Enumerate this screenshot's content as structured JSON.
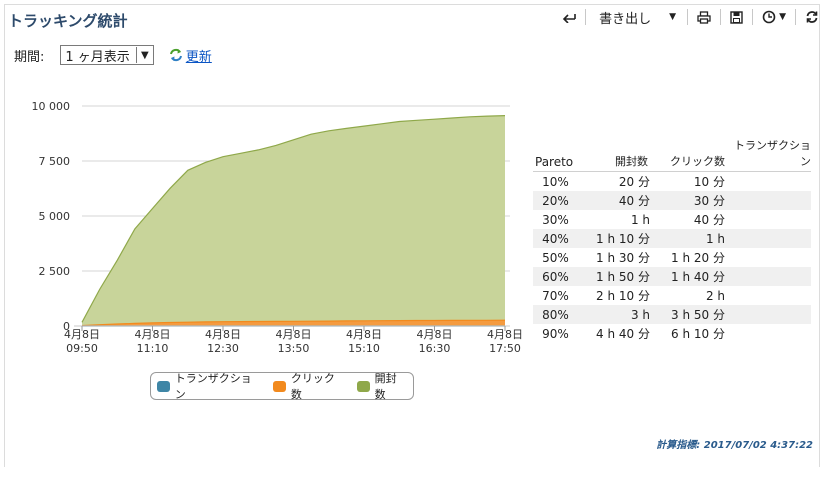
{
  "title": "トラッキング統計",
  "toolbar": {
    "export_label": "書き出し"
  },
  "period": {
    "label": "期間:",
    "selected": "1 ヶ月表示",
    "refresh_label": "更新"
  },
  "chart_data": {
    "type": "area",
    "stacked": true,
    "x": [
      "09:50",
      "10:10",
      "10:30",
      "10:50",
      "11:10",
      "11:30",
      "11:50",
      "12:10",
      "12:30",
      "12:50",
      "13:10",
      "13:30",
      "13:50",
      "14:10",
      "14:30",
      "14:50",
      "15:10",
      "15:30",
      "15:50",
      "16:10",
      "16:30",
      "16:50",
      "17:10",
      "17:30",
      "17:50"
    ],
    "x_ticks": [
      {
        "date": "4月8日",
        "time": "09:50",
        "index": 0
      },
      {
        "date": "4月8日",
        "time": "11:10",
        "index": 4
      },
      {
        "date": "4月8日",
        "time": "12:30",
        "index": 8
      },
      {
        "date": "4月8日",
        "time": "13:50",
        "index": 12
      },
      {
        "date": "4月8日",
        "time": "15:10",
        "index": 16
      },
      {
        "date": "4月8日",
        "time": "16:30",
        "index": 20
      },
      {
        "date": "4月8日",
        "time": "17:50",
        "index": 24
      }
    ],
    "y_ticks": [
      {
        "value": 0,
        "label": "0"
      },
      {
        "value": 2500,
        "label": "2 500"
      },
      {
        "value": 5000,
        "label": "5 000"
      },
      {
        "value": 7500,
        "label": "7 500"
      },
      {
        "value": 10000,
        "label": "10 000"
      }
    ],
    "ylim": [
      0,
      10000
    ],
    "series": [
      {
        "name": "トランザクション",
        "color": "#3f86a6",
        "values": [
          0,
          0,
          0,
          0,
          0,
          0,
          0,
          0,
          0,
          0,
          0,
          0,
          0,
          0,
          0,
          0,
          0,
          0,
          0,
          0,
          0,
          0,
          0,
          0,
          0
        ]
      },
      {
        "name": "クリック数",
        "color": "#f28a1e",
        "values": [
          20,
          60,
          90,
          120,
          140,
          160,
          175,
          185,
          195,
          200,
          205,
          210,
          215,
          220,
          225,
          230,
          235,
          240,
          245,
          250,
          252,
          255,
          258,
          260,
          262
        ]
      },
      {
        "name": "開封数",
        "color": "#8fa84a",
        "fill": "#c8d49a",
        "values": [
          150,
          1600,
          2900,
          4300,
          5200,
          6100,
          6900,
          7250,
          7500,
          7650,
          7800,
          8000,
          8250,
          8500,
          8650,
          8750,
          8850,
          8950,
          9050,
          9100,
          9150,
          9200,
          9250,
          9280,
          9300
        ]
      }
    ],
    "grid": true,
    "legend_position": "bottom"
  },
  "legend": {
    "transaction": "トランザクション",
    "clicks": "クリック数",
    "opens": "開封数"
  },
  "pareto": {
    "headers": [
      "Pareto",
      "開封数",
      "クリック数",
      "トランザクション"
    ],
    "rows": [
      [
        "10%",
        "20 分",
        "10 分",
        ""
      ],
      [
        "20%",
        "40 分",
        "30 分",
        ""
      ],
      [
        "30%",
        "1 h",
        "40 分",
        ""
      ],
      [
        "40%",
        "1 h 10 分",
        "1 h",
        ""
      ],
      [
        "50%",
        "1 h 30 分",
        "1 h 20 分",
        ""
      ],
      [
        "60%",
        "1 h 50 分",
        "1 h 40 分",
        ""
      ],
      [
        "70%",
        "2 h 10 分",
        "2 h",
        ""
      ],
      [
        "80%",
        "3 h",
        "3 h 50 分",
        ""
      ],
      [
        "90%",
        "4 h 40 分",
        "6 h 10 分",
        ""
      ]
    ]
  },
  "calc_label": "計算指標: 2017/07/02 4:37:22"
}
